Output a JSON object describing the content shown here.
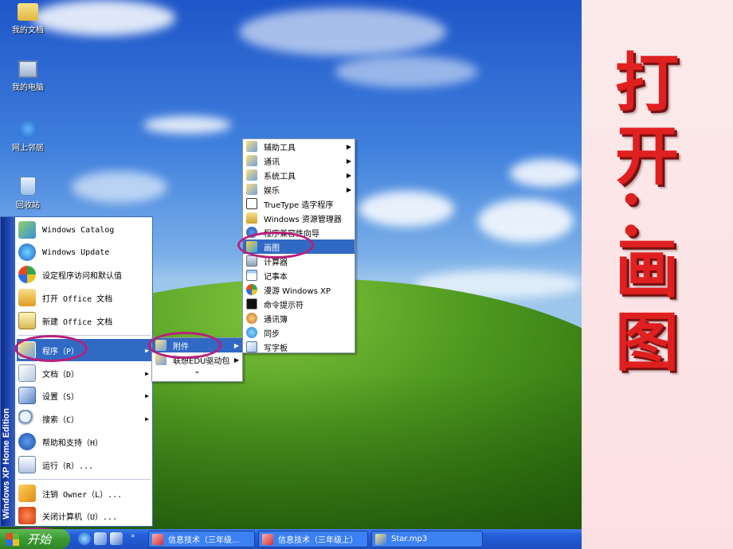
{
  "desktop": {
    "icons": [
      {
        "label": "我的文档",
        "icon": "folder-icon"
      },
      {
        "label": "我的电脑",
        "icon": "computer-icon"
      },
      {
        "label": "网上邻居",
        "icon": "network-icon"
      },
      {
        "label": "回收站",
        "icon": "recycle-bin-icon"
      }
    ]
  },
  "start_menu": {
    "side_banner": "Windows XP Home Edition",
    "items": [
      {
        "label": "Windows Catalog",
        "icon": "catalog-icon"
      },
      {
        "label": "Windows Update",
        "icon": "windows-update-icon"
      },
      {
        "label": "设定程序访问和默认值",
        "icon": "program-access-icon"
      },
      {
        "label": "打开 Office 文档",
        "icon": "open-office-icon"
      },
      {
        "label": "新建 Office 文档",
        "icon": "new-office-icon"
      },
      {
        "label": "程序（P）",
        "icon": "programs-icon",
        "highlighted": true,
        "has_submenu": true
      },
      {
        "label": "文档（D）",
        "icon": "documents-icon",
        "has_submenu": true
      },
      {
        "label": "设置（S）",
        "icon": "settings-icon",
        "has_submenu": true
      },
      {
        "label": "搜索（C）",
        "icon": "search-icon",
        "has_submenu": true
      },
      {
        "label": "帮助和支持（H）",
        "icon": "help-icon"
      },
      {
        "label": "运行（R）...",
        "icon": "run-icon"
      },
      {
        "label": "注销 Owner（L）...",
        "icon": "logoff-icon"
      },
      {
        "label": "关闭计算机（U）...",
        "icon": "shutdown-icon"
      }
    ]
  },
  "programs_submenu": {
    "items": [
      {
        "label": "附件",
        "highlighted": true,
        "has_submenu": true
      },
      {
        "label": "联想EDU驱动包",
        "has_submenu": true
      }
    ],
    "more": "⌄"
  },
  "accessories_submenu": {
    "items": [
      {
        "label": "辅助工具",
        "has_submenu": true
      },
      {
        "label": "通讯",
        "has_submenu": true
      },
      {
        "label": "系统工具",
        "has_submenu": true
      },
      {
        "label": "娱乐",
        "has_submenu": true
      },
      {
        "label": "TrueType 造字程序"
      },
      {
        "label": "Windows 资源管理器"
      },
      {
        "label": "程序兼容性向导"
      },
      {
        "label": "画图",
        "highlighted": true
      },
      {
        "label": "计算器"
      },
      {
        "label": "记事本"
      },
      {
        "label": "漫游 Windows XP"
      },
      {
        "label": "命令提示符"
      },
      {
        "label": "通讯簿"
      },
      {
        "label": "同步"
      },
      {
        "label": "写字板"
      }
    ]
  },
  "taskbar": {
    "start_label": "开始",
    "tasks": [
      {
        "label": "信息技术（三年级..."
      },
      {
        "label": "信息技术（三年级上）"
      },
      {
        "label": "Star.mp3"
      }
    ]
  },
  "slide_title": [
    "打",
    "开",
    "：",
    "画",
    "图"
  ],
  "colors": {
    "highlight": "#316ac5",
    "ring": "#b8207a",
    "title": "#e02020"
  }
}
